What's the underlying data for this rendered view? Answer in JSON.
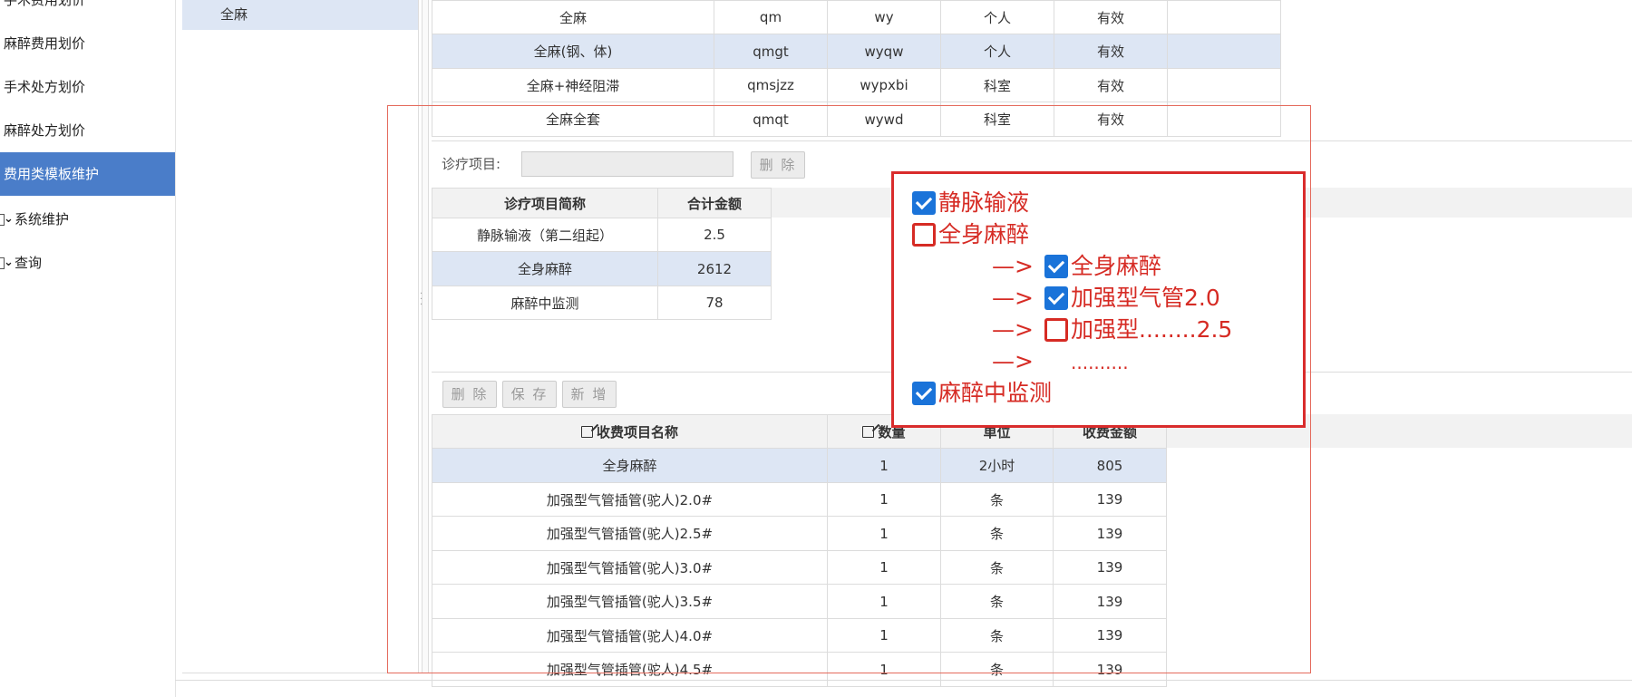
{
  "sidebar": {
    "items": [
      {
        "label": "手术费用划价"
      },
      {
        "label": "麻醉费用划价"
      },
      {
        "label": "手术处方划价"
      },
      {
        "label": "麻醉处方划价"
      },
      {
        "label": "费用类模板维护"
      },
      {
        "label": "系统维护"
      },
      {
        "label": "查询"
      }
    ],
    "chevron": "⌄"
  },
  "template_list": {
    "selected": "全麻"
  },
  "top_table": {
    "rows": [
      [
        "全麻",
        "qm",
        "wy",
        "个人",
        "有效"
      ],
      [
        "全麻(钢、体)",
        "qmgt",
        "wyqw",
        "个人",
        "有效"
      ],
      [
        "全麻+神经阻滞",
        "qmsjzz",
        "wypxbi",
        "科室",
        "有效"
      ],
      [
        "全麻全套",
        "qmqt",
        "wywd",
        "科室",
        "有效"
      ]
    ]
  },
  "diag_form": {
    "label": "诊疗项目:",
    "delete_label": "删 除"
  },
  "diag_table": {
    "headers": [
      "诊疗项目简称",
      "合计金额"
    ],
    "rows": [
      [
        "静脉输液（第二组起）",
        "2.5"
      ],
      [
        "全身麻醉",
        "2612"
      ],
      [
        "麻醉中监测",
        "78"
      ]
    ]
  },
  "toolbar": {
    "delete_label": "删 除",
    "save_label": "保 存",
    "add_label": "新 增"
  },
  "fee_table": {
    "headers": [
      "收费项目名称",
      "数量",
      "单位",
      "收费金额"
    ],
    "rows": [
      [
        "全身麻醉",
        "1",
        "2小时",
        "805"
      ],
      [
        "加强型气管插管(驼人)2.0#",
        "1",
        "条",
        "139"
      ],
      [
        "加强型气管插管(驼人)2.5#",
        "1",
        "条",
        "139"
      ],
      [
        "加强型气管插管(驼人)3.0#",
        "1",
        "条",
        "139"
      ],
      [
        "加强型气管插管(驼人)3.5#",
        "1",
        "条",
        "139"
      ],
      [
        "加强型气管插管(驼人)4.0#",
        "1",
        "条",
        "139"
      ],
      [
        "加强型气管插管(驼人)4.5#",
        "1",
        "条",
        "139"
      ]
    ]
  },
  "annotation": {
    "arrow": "—>",
    "lines": [
      {
        "text": "静脉输液",
        "checked": true
      },
      {
        "text": "全身麻醉",
        "checked": false
      },
      {
        "text": "全身麻醉",
        "checked": true
      },
      {
        "text": "加强型气管2.0",
        "checked": true
      },
      {
        "text": "加强型........2.5",
        "checked": false
      },
      {
        "text": "..........",
        "checked": null
      },
      {
        "text": "麻醉中监测",
        "checked": true
      }
    ]
  },
  "colors": {
    "accent": "#4a7dc9",
    "selected_row": "#dde6f4",
    "annotation_red": "#d62b24",
    "checkbox_blue": "#1a73d9"
  }
}
